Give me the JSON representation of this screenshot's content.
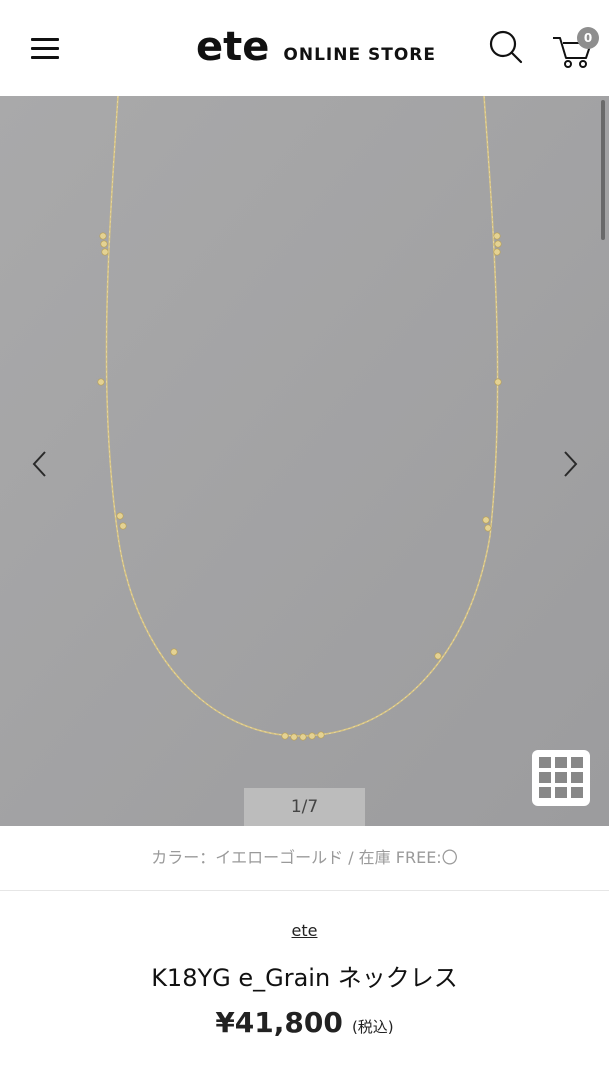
{
  "header": {
    "logo": "ete",
    "store_name": "ONLINE STORE",
    "cart_count": "0"
  },
  "gallery": {
    "counter": "1/7",
    "current_image": 1,
    "total_images": 7
  },
  "product": {
    "variant_text": "カラー：イエローゴールド / 在庫 FREE:〇",
    "brand": "ete",
    "name": "K18YG e_Grain ネックレス",
    "price": "¥41,800",
    "tax_note": "(税込)"
  },
  "colors": {
    "image_background": "#a3a3a4",
    "chain": "#d8c27a",
    "badge": "#8e8e8e"
  },
  "icons": {
    "menu": "hamburger-icon",
    "search": "search-icon",
    "cart": "cart-icon",
    "prev": "chevron-left-icon",
    "next": "chevron-right-icon",
    "grid": "grid-icon"
  }
}
